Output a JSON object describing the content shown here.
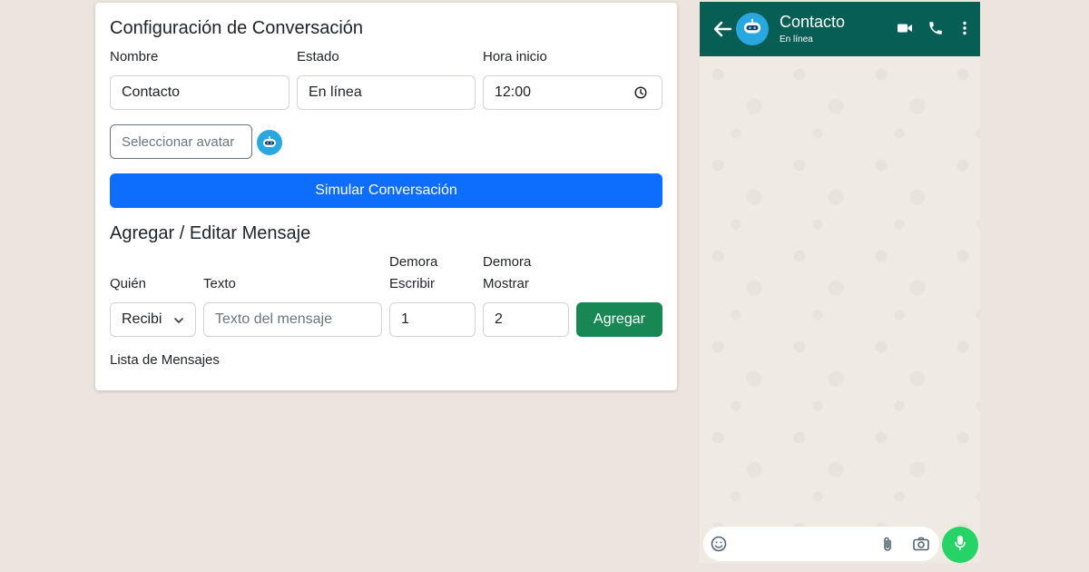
{
  "config": {
    "title": "Configuración de Conversación",
    "name_label": "Nombre",
    "name_value": "Contacto",
    "status_label": "Estado",
    "status_value": "En línea",
    "time_label": "Hora inicio",
    "time_value": "12:00",
    "avatar_button": "Seleccionar avatar",
    "simulate_button": "Simular Conversación"
  },
  "message_form": {
    "title": "Agregar / Editar Mensaje",
    "who_label": "Quién",
    "who_value": "Recibi",
    "text_label": "Texto",
    "text_placeholder": "Texto del mensaje",
    "delay_write_label_1": "Demora",
    "delay_write_label_2": "Escribir",
    "delay_write_value": "1",
    "delay_show_label_1": "Demora",
    "delay_show_label_2": "Mostrar",
    "delay_show_value": "2",
    "add_button": "Agregar",
    "list_title": "Lista de Mensajes"
  },
  "chat": {
    "contact_name": "Contacto",
    "contact_status": "En línea",
    "header_color": "#075e54",
    "mic_color": "#25d366",
    "icons": [
      "back-arrow-icon",
      "bot-avatar-icon",
      "video-call-icon",
      "phone-icon",
      "more-vert-icon",
      "sticker-icon",
      "attach-icon",
      "camera-icon",
      "mic-icon"
    ]
  },
  "colors": {
    "primary": "#0d6efd",
    "success": "#198754",
    "background": "#ece5dd"
  }
}
